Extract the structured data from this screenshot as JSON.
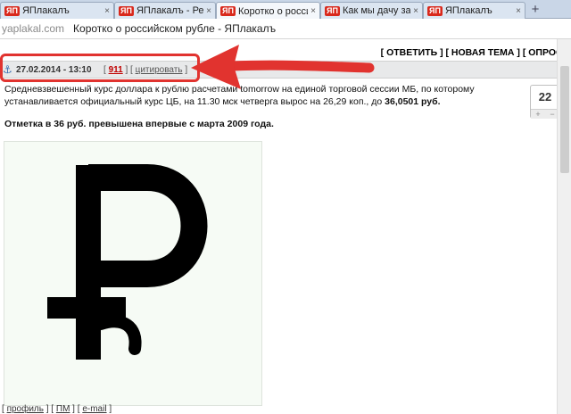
{
  "tabs": [
    {
      "logo": "ЯП",
      "title": "ЯПлакалъ",
      "active": false
    },
    {
      "logo": "ЯП",
      "title": "ЯПлакалъ - Результат",
      "active": false
    },
    {
      "logo": "ЯП",
      "title": "Коротко о российском",
      "active": true
    },
    {
      "logo": "ЯП",
      "title": "Как мы дачу запилил",
      "active": false
    },
    {
      "logo": "ЯП",
      "title": "ЯПлакалъ",
      "active": false
    }
  ],
  "tab_close": "×",
  "new_tab": "+",
  "address": {
    "domain": "yaplakal.com",
    "title": "Коротко о российском рубле - ЯПлакалъ"
  },
  "actions": "[ ОТВЕТИТЬ ] [ НОВАЯ ТЕМА ] [ ОПРОС ]",
  "post": {
    "anchor_icon": "⚓",
    "date": "27.02.2014 - 13:10",
    "link_open": "[",
    "post_number": "911",
    "link_mid": "] [",
    "cite_label": "цитировать",
    "link_close": "]",
    "text_line1": "Средневзвешенный курс доллара к рублю расчетами tomorrow на единой торговой сессии МБ, по которому",
    "text_line2_a": "устанавливается официальный курс ЦБ, на 11.30 мск четверга вырос на 26,29 коп., до ",
    "text_line2_b": "36,0501 руб.",
    "text_bold": "Отметка в 36 руб. превышена впервые с марта 2009 года."
  },
  "rating": {
    "value": "22",
    "plus": "+",
    "minus": "−"
  },
  "footer": {
    "profile_open": "[ ",
    "profile": "профиль",
    "profile_close": " ]",
    "pm_open": " [ ",
    "pm": "ПМ",
    "pm_close": " ]",
    "email_open": " [ ",
    "email": "e-mail",
    "email_close": " ]"
  },
  "colors": {
    "highlight": "#e1332f",
    "post_number": "#c00000",
    "tab_logo": "#d9291c"
  }
}
